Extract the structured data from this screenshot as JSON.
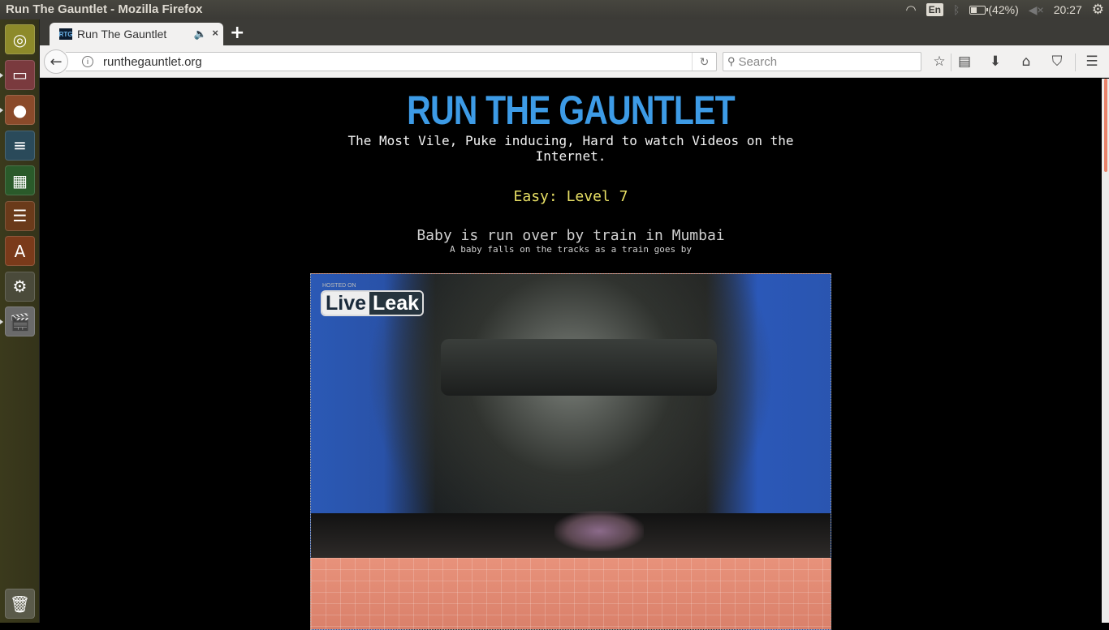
{
  "os": {
    "window_title": "Run The Gauntlet - Mozilla Firefox",
    "indicators": {
      "keyboard_layout": "En",
      "battery_percent": 42,
      "battery_label": "(42%)",
      "clock": "20:27",
      "icons": [
        "wifi-icon",
        "keyboard-icon",
        "bluetooth-icon",
        "battery-icon",
        "volume-muted-icon",
        "power-gear-icon"
      ]
    },
    "launcher": {
      "items": [
        {
          "name": "ubuntu-dash",
          "icon": "ubuntu-logo-icon",
          "color": "#8d8a2a",
          "glyph": "◎"
        },
        {
          "name": "files",
          "icon": "file-cabinet-icon",
          "color": "#7a3a3e",
          "glyph": "▭"
        },
        {
          "name": "firefox",
          "icon": "firefox-icon",
          "color": "#8a4a2a",
          "glyph": "●"
        },
        {
          "name": "libreoffice-writer",
          "icon": "writer-doc-icon",
          "color": "#2a4a5a",
          "glyph": "≡"
        },
        {
          "name": "libreoffice-calc",
          "icon": "calc-sheet-icon",
          "color": "#2a5a2a",
          "glyph": "▦"
        },
        {
          "name": "libreoffice-impress",
          "icon": "impress-slides-icon",
          "color": "#6a3a1a",
          "glyph": "☰"
        },
        {
          "name": "software-center",
          "icon": "software-center-icon",
          "color": "#7a3a1a",
          "glyph": "A"
        },
        {
          "name": "system-settings",
          "icon": "settings-wrench-icon",
          "color": "#4a4a3a",
          "glyph": "⚙"
        },
        {
          "name": "video-editor",
          "icon": "clapperboard-icon",
          "color": "#6a6a6a",
          "glyph": "🎬"
        }
      ],
      "trash": {
        "name": "trash",
        "icon": "trash-icon"
      }
    }
  },
  "browser": {
    "tab": {
      "title": "Run The Gauntlet",
      "favicon": "RTG",
      "audio_icon": "speaker-icon",
      "close": "×"
    },
    "new_tab": "+",
    "url": "runthegauntlet.org",
    "search_placeholder": "Search",
    "toolbar_icons": [
      "bookmark-star-icon",
      "reading-list-icon",
      "download-icon",
      "home-icon",
      "pocket-icon",
      "menu-hamburger-icon"
    ],
    "glyphs": {
      "back": "←",
      "info": "i",
      "reload": "↻",
      "search": "🔍",
      "star": "☆",
      "list": "▤",
      "download": "⬇",
      "home": "⌂",
      "pocket": "⛉",
      "menu": "☰"
    }
  },
  "page": {
    "logo": "RUN THE GAUNTLET",
    "tagline": "The Most Vile, Puke inducing, Hard to watch Videos on the Internet.",
    "level": "Easy: Level 7",
    "video_title": "Baby is run over by train in Mumbai",
    "video_description": "A baby falls on the tracks as a train goes by",
    "video_watermark": {
      "hosted_on": "HOSTED ON",
      "brand_left": "Live",
      "brand_right": "Leak"
    }
  },
  "colors": {
    "logo": "#3d9be6",
    "level": "#e8e065",
    "scrollbar_thumb": "#e8826b"
  }
}
